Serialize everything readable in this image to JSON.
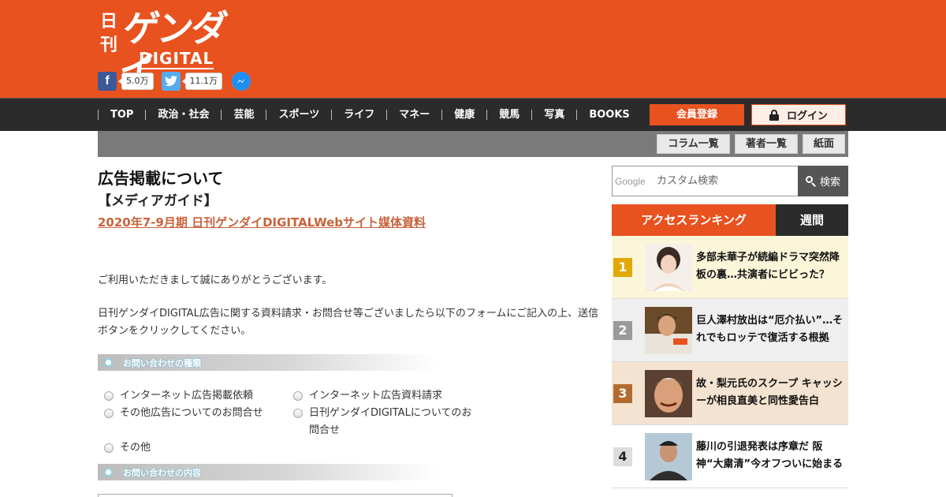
{
  "header": {
    "logo_small": "日刊",
    "logo_main": "ゲンダイ",
    "logo_sub": "DIGITAL",
    "social": {
      "facebook_count": "5.0万",
      "twitter_count": "11.1万"
    }
  },
  "nav": {
    "items": [
      "TOP",
      "政治・社会",
      "芸能",
      "スポーツ",
      "ライフ",
      "マネー",
      "健康",
      "競馬",
      "写真",
      "BOOKS"
    ],
    "register_label": "会員登録",
    "login_label": "ログイン"
  },
  "subnav": {
    "items": [
      "コラム一覧",
      "著者一覧",
      "紙面"
    ]
  },
  "main": {
    "title": "広告掲載について",
    "subtitle": "【メディアガイド】",
    "media_link": "2020年7-9月期 日刊ゲンダイDIGITALWebサイト媒体資料",
    "para1": "ご利用いただきまして誠にありがとうございます。",
    "para2": "日刊ゲンダイDIGITAL広告に関する資料請求・お問合せ等ございましたら以下のフォームにご記入の上、送信ボタンをクリックしてください。",
    "section1_label": "お問い合わせの種類",
    "section2_label": "お問い合わせの内容",
    "options": [
      "インターネット広告掲載依頼",
      "インターネット広告資料請求",
      "その他広告についてのお問合せ",
      "日刊ゲンダイDIGITALについてのお問合せ",
      "その他"
    ]
  },
  "sidebar": {
    "search_placeholder": "カスタム検索",
    "search_brand": "Google",
    "search_button": "検索",
    "ranking_tab": "アクセスランキング",
    "ranking_period": "週間",
    "ranking": [
      {
        "rank": "1",
        "title": "多部未華子が続編ドラマ突然降板の裏…共演者にビビった？",
        "color": "#e0a800",
        "bg": "#fbf6d9"
      },
      {
        "rank": "2",
        "title": "巨人澤村放出は“厄介払い”…それでもロッテで復活する根拠",
        "color": "#9a9a9a",
        "bg": "#efefef"
      },
      {
        "rank": "3",
        "title": "故・梨元氏のスクープ キャッシーが相良直美と同性愛告白",
        "color": "#b26b2f",
        "bg": "#f3e3d0"
      },
      {
        "rank": "4",
        "title": "藤川の引退発表は序章だ 阪神“大粛清”今オフついに始まる",
        "color": "#fff",
        "bg": "#ffffff"
      }
    ]
  },
  "colors": {
    "brand": "#e8521f",
    "nav_bg": "#2b2b2b",
    "link": "#c9633b"
  }
}
